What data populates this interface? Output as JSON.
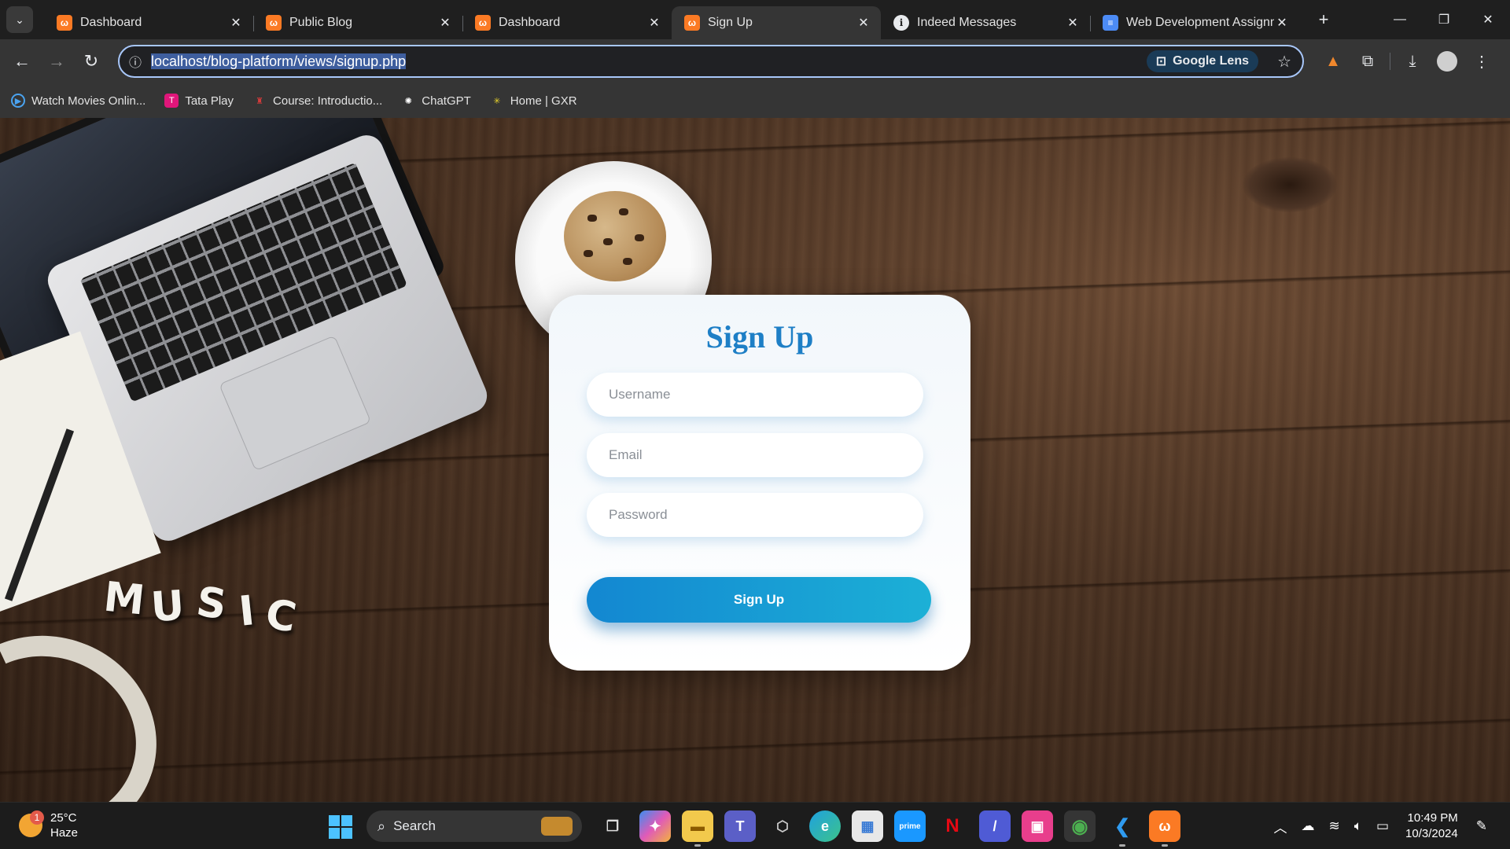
{
  "browser": {
    "tabs": [
      {
        "title": "Dashboard",
        "icon": "xampp-icon",
        "active": false
      },
      {
        "title": "Public Blog",
        "icon": "xampp-icon",
        "active": false
      },
      {
        "title": "Dashboard",
        "icon": "xampp-icon",
        "active": false
      },
      {
        "title": "Sign Up",
        "icon": "xampp-icon",
        "active": true
      },
      {
        "title": "Indeed Messages",
        "icon": "info-icon",
        "active": false
      },
      {
        "title": "Web Development Assignm",
        "icon": "docs-icon",
        "active": false
      }
    ],
    "url": "localhost/blog-platform/views/signup.php",
    "lens_label": "Google Lens",
    "bookmarks": [
      {
        "label": "Watch Movies Onlin..."
      },
      {
        "label": "Tata Play"
      },
      {
        "label": "Course: Introductio..."
      },
      {
        "label": "ChatGPT"
      },
      {
        "label": "Home | GXR"
      }
    ]
  },
  "page": {
    "background_word": [
      "M",
      "U",
      "S",
      "I",
      "C"
    ],
    "form": {
      "title": "Sign Up",
      "username_placeholder": "Username",
      "email_placeholder": "Email",
      "password_placeholder": "Password",
      "submit_label": "Sign Up"
    },
    "colors": {
      "title": "#1e7fc6",
      "button_start": "#1387d1",
      "button_end": "#1cb0d6"
    }
  },
  "taskbar": {
    "weather_temp": "25°C",
    "weather_desc": "Haze",
    "weather_badge": "1",
    "search_label": "Search",
    "time": "10:49 PM",
    "date": "10/3/2024"
  }
}
